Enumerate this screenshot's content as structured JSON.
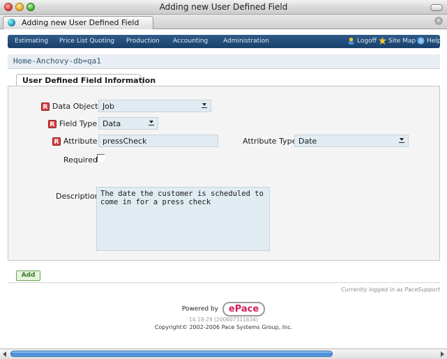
{
  "window": {
    "title": "Adding new User Defined Field"
  },
  "browser_tab": {
    "label": "Adding new User Defined Field"
  },
  "nav": {
    "items": [
      "Estimating",
      "Price List Quoting",
      "Production",
      "Accounting",
      "Administration"
    ],
    "logoff": "Logoff",
    "site_map": "Site Map",
    "help": "Help"
  },
  "breadcrumb": "Home-Anchovy-db=qa1",
  "section": {
    "tab_label": "User Defined Field Information"
  },
  "form": {
    "required_marker": "R",
    "data_object": {
      "label": "Data Object",
      "value": "Job"
    },
    "field_type": {
      "label": "Field Type",
      "value": "Data"
    },
    "attribute": {
      "label": "Attribute",
      "value": "pressCheck"
    },
    "attribute_type": {
      "label": "Attribute Type",
      "value": "Date"
    },
    "required": {
      "label": "Required",
      "checked": false
    },
    "description": {
      "label": "Description",
      "value": "The date the customer is scheduled to\ncome in for a press check"
    }
  },
  "actions": {
    "add_label": "Add"
  },
  "footer": {
    "logged_in": "Currently logged in as PaceSupport",
    "powered_by": "Powered by",
    "logo_text": "ePace",
    "version": "14.18-29 (200607311634)",
    "copyright": "Copyright© 2002-2006 Pace Systems Group, Inc."
  },
  "colors": {
    "nav_background": "#1f4672",
    "required_badge": "#d64343",
    "field_background": "#e1ebf2",
    "add_button_text": "#3a7a2a",
    "logo_accent": "#d11f5a"
  },
  "icons": [
    "close-button",
    "minimize-button",
    "zoom-button",
    "globe-favicon",
    "tab-close-icon",
    "logoff-icon",
    "site-map-icon",
    "help-icon",
    "select-arrow-icon",
    "scroll-arrow-icon"
  ]
}
